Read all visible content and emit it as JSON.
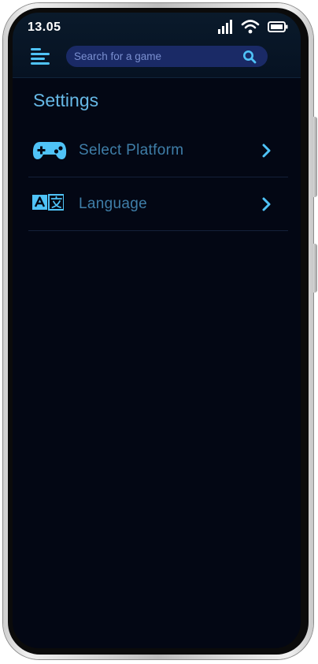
{
  "status_bar": {
    "time": "13.05",
    "icons": [
      "signal-icon",
      "wifi-icon",
      "battery-icon"
    ]
  },
  "header": {
    "menu_icon": "hamburger-menu-icon",
    "search": {
      "placeholder": "Search for a game",
      "value": "",
      "icon": "search-icon"
    }
  },
  "page": {
    "title": "Settings"
  },
  "settings": {
    "items": [
      {
        "label": "Select Platform",
        "icon": "gamepad-icon",
        "chevron": "chevron-right-icon"
      },
      {
        "label": "Language",
        "icon": "translate-icon",
        "chevron": "chevron-right-icon"
      }
    ]
  },
  "colors": {
    "background": "#030714",
    "header": "#061222",
    "search_bg": "#1a2a66",
    "accent": "#4fc3f7",
    "title": "#66b8e6",
    "item_text": "#3f7ea8"
  }
}
